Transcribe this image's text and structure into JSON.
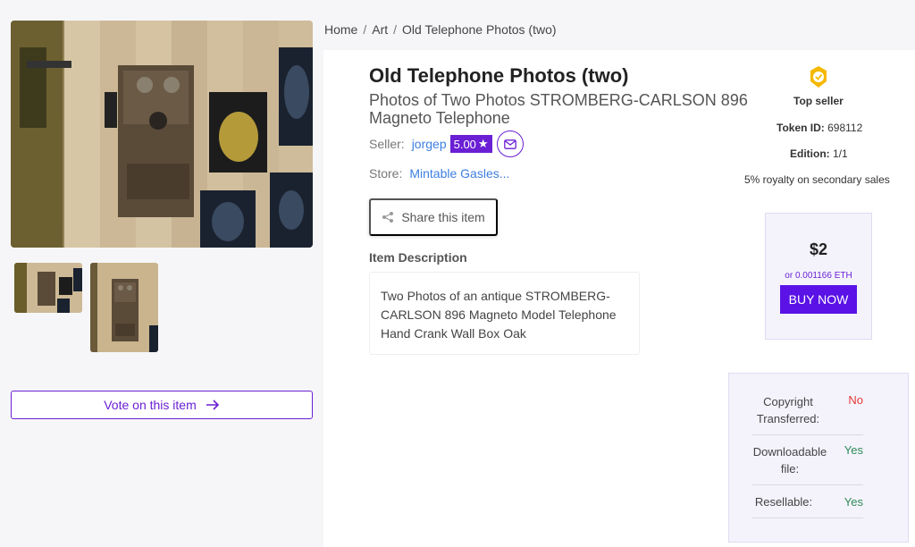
{
  "breadcrumb": [
    "Home",
    "Art",
    "Old Telephone Photos (two)"
  ],
  "item": {
    "title": "Old Telephone Photos (two)",
    "subtitle": "Photos of Two Photos STROMBERG-CARLSON 896 Magneto Telephone",
    "seller_label": "Seller:",
    "seller_name": "jorgep",
    "rating": "5.00",
    "store_label": "Store:",
    "store_name": "Mintable Gasles...",
    "share_label": "Share this item",
    "description_title": "Item Description",
    "description": "Two Photos of an antique STROMBERG-CARLSON 896 Magneto Model Telephone Hand Crank Wall Box Oak"
  },
  "vote_label": "Vote on this item",
  "info": {
    "top_seller": "Top seller",
    "token_label": "Token ID:",
    "token_value": "698112",
    "edition_label": "Edition:",
    "edition_value": "1/1",
    "royalty": "5% royalty on secondary sales"
  },
  "purchase": {
    "price": "$2",
    "eth": "or 0.001166 ETH",
    "buy_label": "BUY NOW"
  },
  "rights": [
    {
      "label": "Copyright Transferred:",
      "value": "No"
    },
    {
      "label": "Downloadable file:",
      "value": "Yes"
    },
    {
      "label": "Resellable:",
      "value": "Yes"
    }
  ],
  "colors": {
    "accent": "#6a1fd4",
    "buy": "#5a12e6",
    "link": "#3d7fe0",
    "no": "#e53935",
    "yes": "#2e8b57"
  }
}
